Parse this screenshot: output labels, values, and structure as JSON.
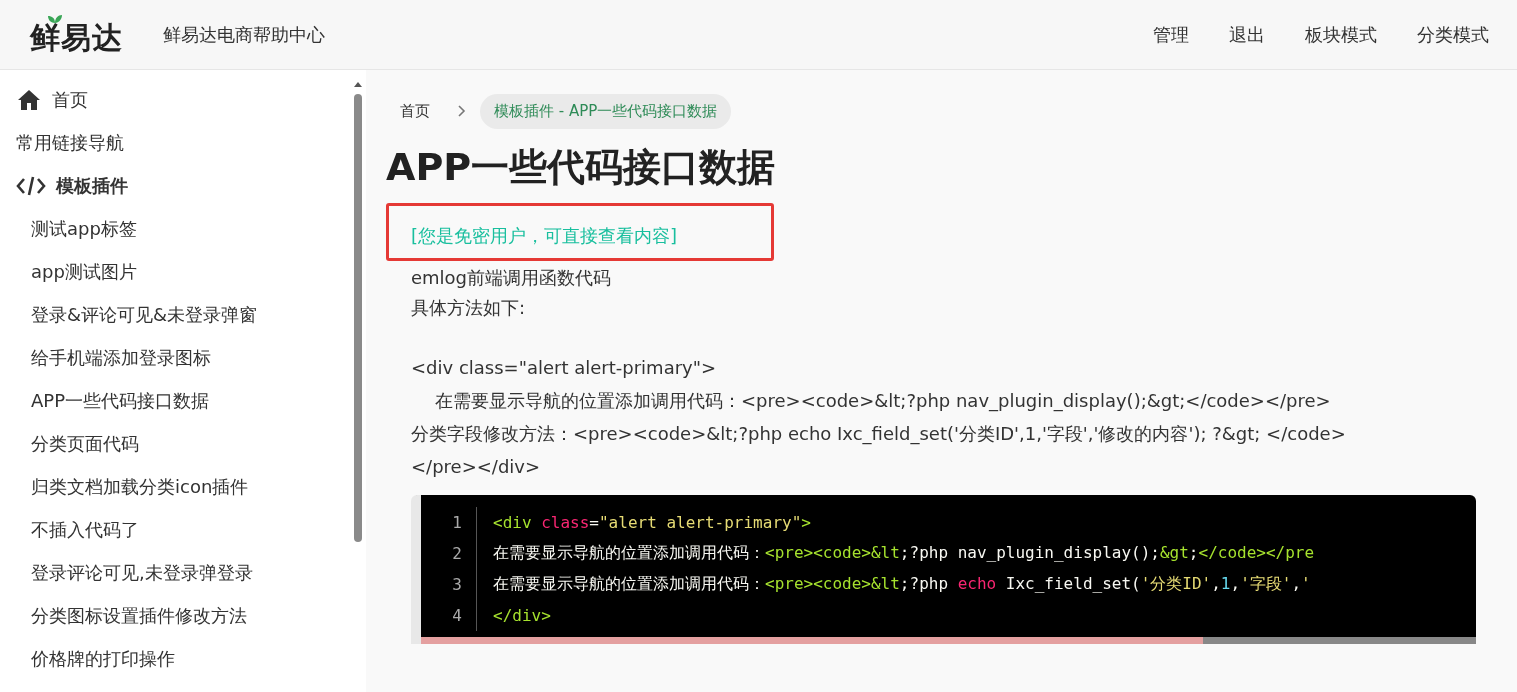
{
  "header": {
    "logo": "鲜易达",
    "site_title": "鲜易达电商帮助中心",
    "nav": [
      "管理",
      "退出",
      "板块模式",
      "分类模式"
    ]
  },
  "sidebar": {
    "items": [
      {
        "label": "首页",
        "kind": "home"
      },
      {
        "label": "常用链接导航",
        "kind": "plain"
      },
      {
        "label": "模板插件",
        "kind": "code",
        "children": [
          {
            "label": "测试app标签"
          },
          {
            "label": "app测试图片"
          },
          {
            "label": "登录&评论可见&未登录弹窗"
          },
          {
            "label": "给手机端添加登录图标"
          },
          {
            "label": "APP一些代码接口数据"
          },
          {
            "label": "分类页面代码"
          },
          {
            "label": "归类文档加载分类icon插件"
          },
          {
            "label": "不插入代码了"
          },
          {
            "label": "登录评论可见,未登录弹登录"
          },
          {
            "label": "分类图标设置插件修改方法"
          },
          {
            "label": "价格牌的打印操作"
          }
        ]
      }
    ]
  },
  "breadcrumb": [
    {
      "label": "首页",
      "selected": false
    },
    {
      "label": "模板插件 - APP一些代码接口数据",
      "selected": true
    }
  ],
  "article": {
    "title": "APP一些代码接口数据",
    "notice": "[您是免密用户，可直接查看内容]",
    "paragraphs": [
      "emlog前端调用函数代码",
      "具体方法如下:"
    ],
    "html_lines": [
      "<div class=\"alert alert-primary\">",
      "在需要显示导航的位置添加调用代码：<pre><code>&lt;?php nav_plugin_display();&gt;</code></pre>",
      "分类字段修改方法：<pre><code>&lt;?php echo Ixc_field_set('分类ID',1,'字段','修改的内容'); ?&gt; </code>",
      "</pre></div>"
    ],
    "code_block": {
      "lines": [
        {
          "number": "1",
          "tokens": [
            {
              "kind": "tag",
              "text": "<div "
            },
            {
              "kind": "attr",
              "text": "class"
            },
            {
              "kind": "plain",
              "text": "="
            },
            {
              "kind": "string",
              "text": "\"alert alert-primary\""
            },
            {
              "kind": "tag",
              "text": ">"
            }
          ]
        },
        {
          "number": "2",
          "tokens": [
            {
              "kind": "plain",
              "text": "在需要显示导航的位置添加调用代码："
            },
            {
              "kind": "tag",
              "text": "<pre><code>&lt"
            },
            {
              "kind": "plain",
              "text": ";?php nav_plugin_display();"
            },
            {
              "kind": "tag",
              "text": "&gt"
            },
            {
              "kind": "plain",
              "text": ";"
            },
            {
              "kind": "tag",
              "text": "</code></pre"
            }
          ]
        },
        {
          "number": "3",
          "tokens": [
            {
              "kind": "plain",
              "text": "在需要显示导航的位置添加调用代码："
            },
            {
              "kind": "tag",
              "text": "<pre><code>&lt"
            },
            {
              "kind": "plain",
              "text": ";?php "
            },
            {
              "kind": "attr",
              "text": "echo"
            },
            {
              "kind": "plain",
              "text": " Ixc_field_set("
            },
            {
              "kind": "string",
              "text": "'分类ID'"
            },
            {
              "kind": "plain",
              "text": ","
            },
            {
              "kind": "number",
              "text": "1"
            },
            {
              "kind": "plain",
              "text": ","
            },
            {
              "kind": "string",
              "text": "'字段'"
            },
            {
              "kind": "plain",
              "text": ","
            },
            {
              "kind": "string",
              "text": "'"
            }
          ]
        },
        {
          "number": "4",
          "tokens": [
            {
              "kind": "tag",
              "text": "</div>"
            }
          ]
        }
      ]
    }
  }
}
